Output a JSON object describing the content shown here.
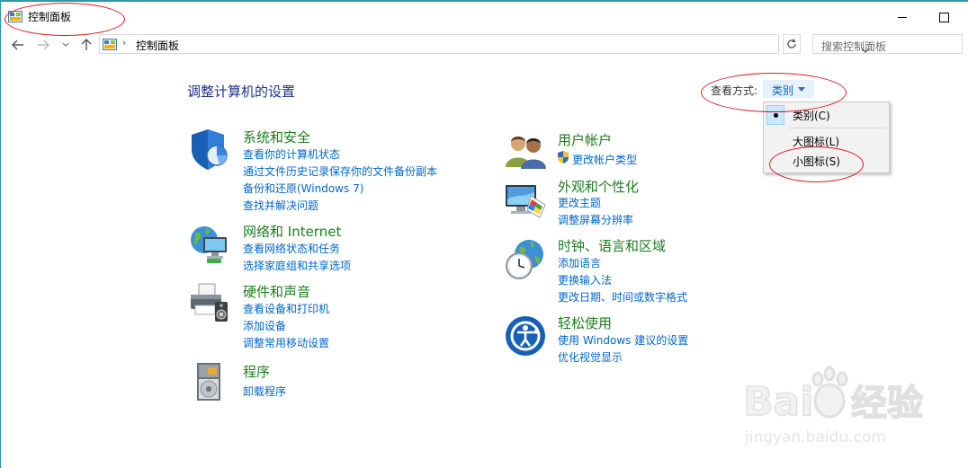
{
  "window": {
    "title": "控制面板"
  },
  "address_bar": {
    "path": "控制面板",
    "separator": "›"
  },
  "search": {
    "placeholder": "搜索控制面板"
  },
  "header": {
    "title": "调整计算机的设置"
  },
  "view_by": {
    "label": "查看方式:",
    "value": "类别",
    "options": [
      "类别(C)",
      "大图标(L)",
      "小图标(S)"
    ],
    "selected_index": 0
  },
  "categories": [
    {
      "title": "系统和安全",
      "links": [
        "查看你的计算机状态",
        "通过文件历史记录保存你的文件备份副本",
        "备份和还原(Windows 7)",
        "查找并解决问题"
      ],
      "icon": "shield-icon"
    },
    {
      "title": "网络和 Internet",
      "links": [
        "查看网络状态和任务",
        "选择家庭组和共享选项"
      ],
      "icon": "network-globe-icon"
    },
    {
      "title": "硬件和声音",
      "links": [
        "查看设备和打印机",
        "添加设备",
        "调整常用移动设置"
      ],
      "icon": "printer-icon"
    },
    {
      "title": "程序",
      "links": [
        "卸载程序"
      ],
      "icon": "programs-disc-icon"
    },
    {
      "title": "用户帐户",
      "links": [
        "更改帐户类型"
      ],
      "icon": "users-icon"
    },
    {
      "title": "外观和个性化",
      "links": [
        "更改主题",
        "调整屏幕分辨率"
      ],
      "icon": "display-appearance-icon"
    },
    {
      "title": "时钟、语言和区域",
      "links": [
        "添加语言",
        "更换输入法",
        "更改日期、时间或数字格式"
      ],
      "icon": "clock-globe-icon"
    },
    {
      "title": "轻松使用",
      "links": [
        "使用 Windows 建议的设置",
        "优化视觉显示"
      ],
      "icon": "ease-of-access-icon"
    }
  ],
  "watermark": {
    "brand": "Bai经验",
    "url": "jingyan.baidu.com"
  },
  "colors": {
    "link": "#0066cc",
    "category_title": "#1e7d1e",
    "page_title": "#1e3287",
    "annotation": "#d7191c"
  }
}
